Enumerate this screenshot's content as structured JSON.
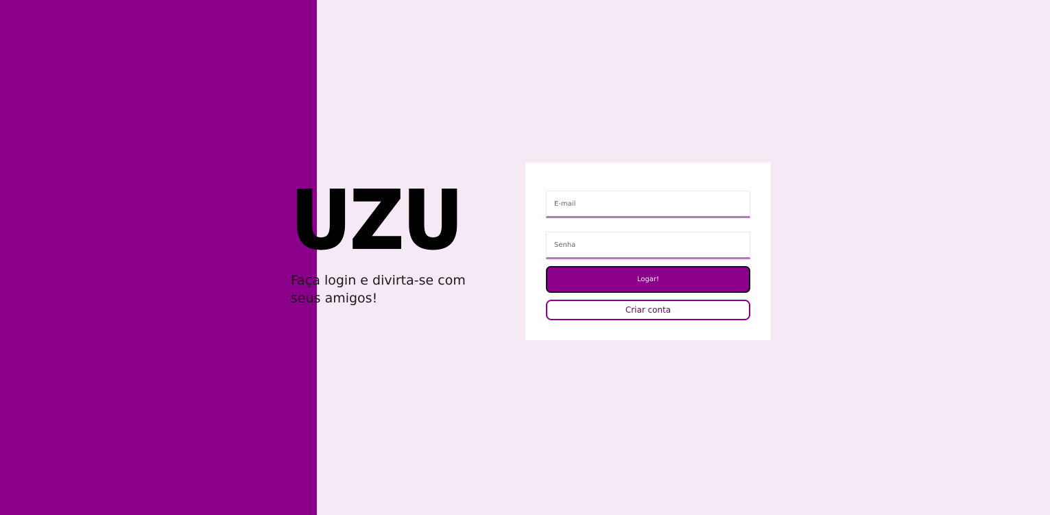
{
  "brand": {
    "logo_text": "UZU",
    "tagline": "Faça login e divirta-se com seus amigos!"
  },
  "login_form": {
    "email_placeholder": "E-mail",
    "email_value": "",
    "password_placeholder": "Senha",
    "password_value": "",
    "login_button_label": "Logar!",
    "create_account_button_label": "Criar conta"
  },
  "colors": {
    "accent": "#8b008b",
    "page_background": "#f5e9f5",
    "card_background": "#ffffff",
    "input_underline": "#b07ab8"
  }
}
